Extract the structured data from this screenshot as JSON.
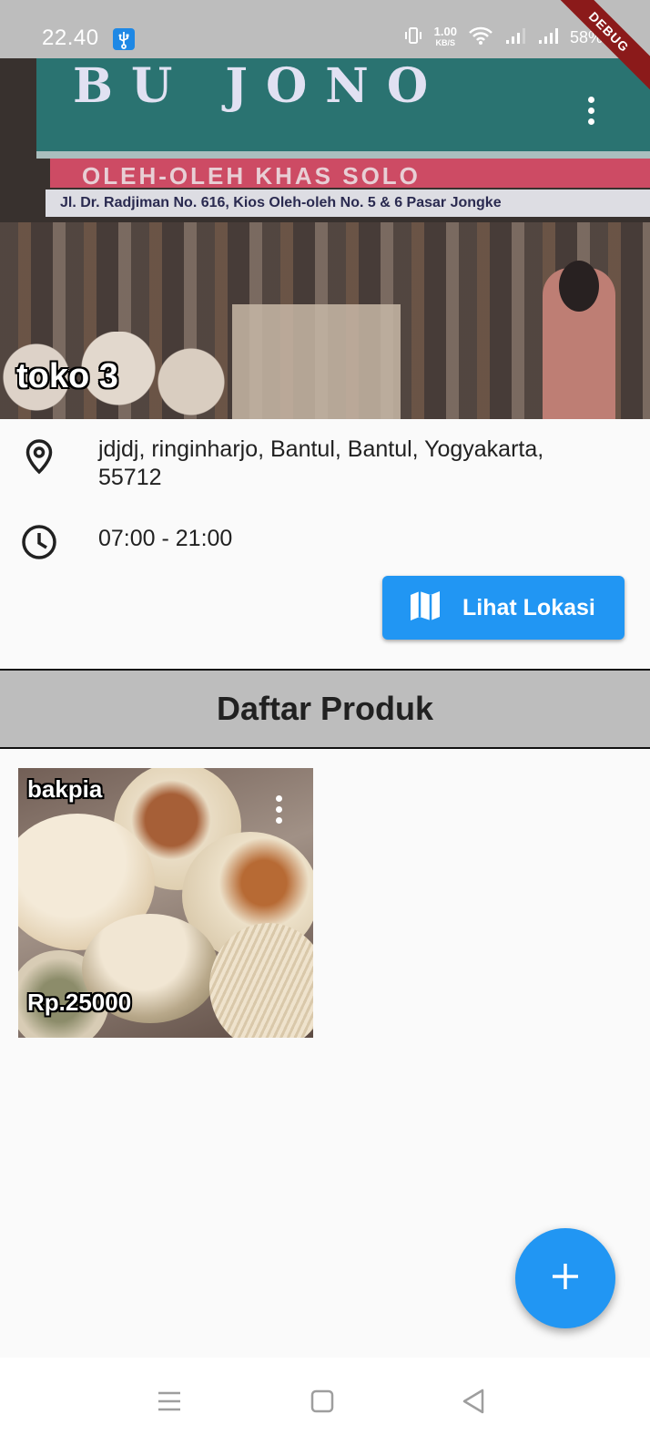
{
  "status_bar": {
    "time": "22.40",
    "net_speed_value": "1.00",
    "net_speed_unit": "KB/S",
    "battery": "58%"
  },
  "debug_banner": "DEBUG",
  "hero": {
    "shop_name": "toko 3",
    "sign_title": "BU JONO",
    "sign_subtitle": "OLEH-OLEH KHAS SOLO",
    "sign_address": "Jl. Dr. Radjiman No. 616, Kios Oleh-oleh No. 5 & 6 Pasar Jongke"
  },
  "info": {
    "address": "jdjdj, ringinharjo, Bantul, Bantul, Yogyakarta, 55712",
    "hours": "07:00 - 21:00",
    "location_icon": "location-pin-icon",
    "clock_icon": "clock-icon"
  },
  "map_button": {
    "label": "Lihat Lokasi",
    "icon": "map-icon"
  },
  "products_section": {
    "title": "Daftar Produk",
    "items": [
      {
        "name": "bakpia",
        "price": "Rp.25000"
      }
    ]
  },
  "fab": {
    "icon": "plus-icon"
  },
  "nav": {
    "icons": [
      "menu-icon",
      "home-square-icon",
      "back-triangle-icon"
    ]
  },
  "colors": {
    "primary": "#2196f3",
    "status_bar": "#bdbdbd",
    "section_header": "#bdbdbd",
    "debug": "#8b1a1a"
  }
}
